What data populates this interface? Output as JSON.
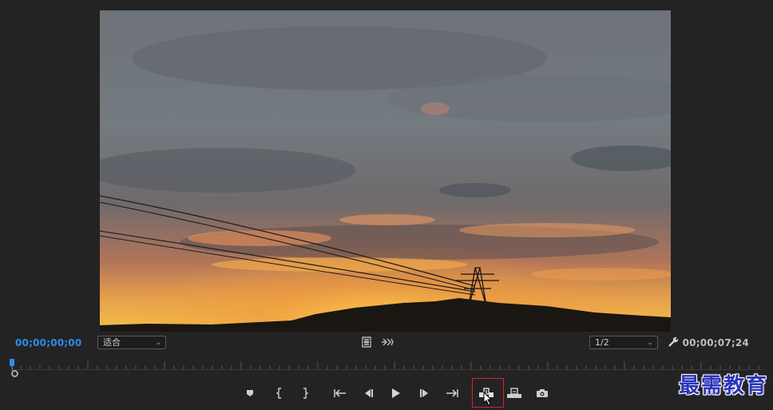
{
  "timecode": {
    "current": "00;00;00;00",
    "duration": "00;00;07;24"
  },
  "fit_dropdown": {
    "value": "适合"
  },
  "resolution_dropdown": {
    "value": "1/2"
  },
  "watermark_text": "最需教育",
  "colors": {
    "accent": "#2d8ceb",
    "highlight": "#d9232a",
    "watermark": "#2a35b8"
  },
  "transport_buttons": [
    {
      "name": "add-marker-icon"
    },
    {
      "name": "mark-in-icon"
    },
    {
      "name": "mark-out-icon"
    },
    {
      "name": "go-to-in-icon"
    },
    {
      "name": "step-back-icon"
    },
    {
      "name": "play-icon"
    },
    {
      "name": "step-forward-icon"
    },
    {
      "name": "go-to-out-icon"
    },
    {
      "name": "insert-icon"
    },
    {
      "name": "overwrite-icon"
    },
    {
      "name": "export-frame-icon"
    }
  ]
}
